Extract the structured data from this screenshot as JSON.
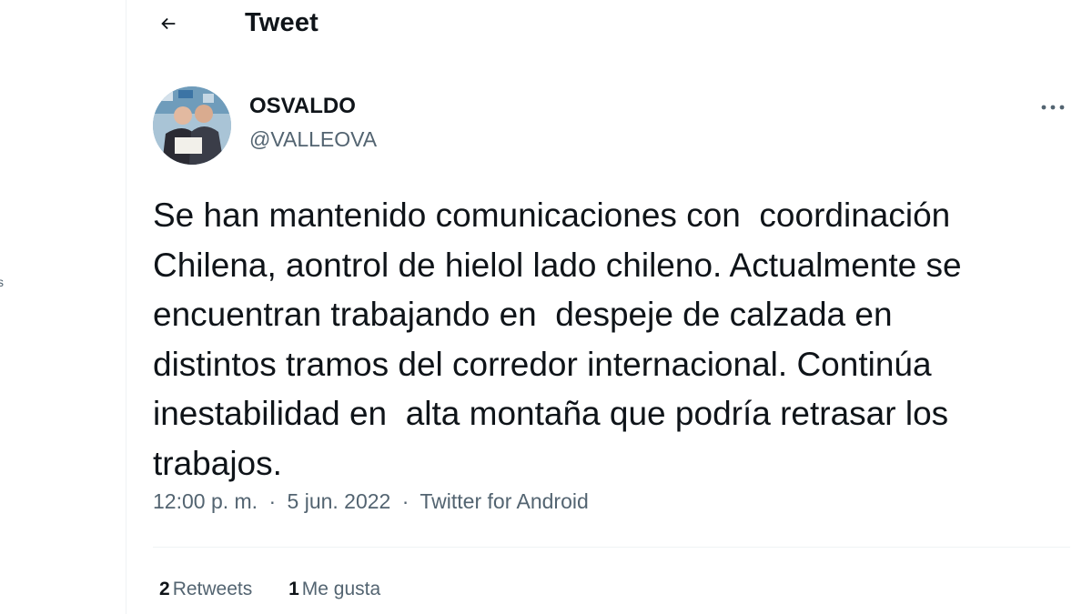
{
  "header": {
    "title": "Tweet",
    "back_icon": "arrow-left-icon"
  },
  "author": {
    "name": "OSVALDO",
    "handle": "@VALLEOVA",
    "avatar_icon": "profile-photo"
  },
  "tweet": {
    "text": "Se han mantenido comunicaciones con  coordinación\nChilena, aontrol de hielol lado chileno. Actualmente se\nencuentran trabajando en  despeje de calzada en\ndistintos tramos del corredor internacional. Continúa\ninestabilidad en  alta montaña que podría retrasar los\ntrabajos.",
    "time": "12:00 p. m.",
    "date": "5 jun. 2022",
    "separator": "·",
    "source": "Twitter for Android"
  },
  "stats": {
    "retweets_count": "2",
    "retweets_label": "Retweets",
    "likes_count": "1",
    "likes_label": "Me gusta"
  },
  "left_rail": {
    "fragment": "s"
  },
  "colors": {
    "text_primary": "#0f1419",
    "text_secondary": "#536471",
    "border": "#eff3f4",
    "background": "#ffffff"
  }
}
